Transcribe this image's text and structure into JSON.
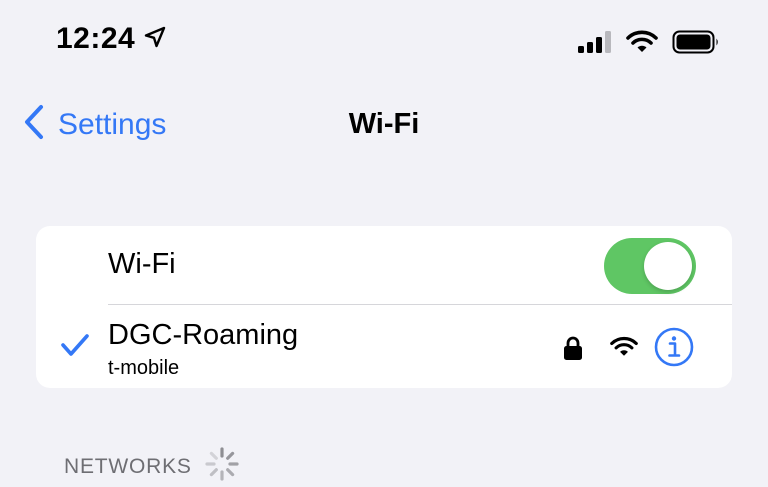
{
  "status_bar": {
    "time": "12:24",
    "icons": [
      "location-arrow-icon",
      "cellular-signal-icon",
      "wifi-icon",
      "battery-icon"
    ]
  },
  "nav": {
    "back_label": "Settings",
    "title": "Wi-Fi"
  },
  "wifi_toggle": {
    "label": "Wi-Fi",
    "on": true
  },
  "connected_network": {
    "name": "DGC-Roaming",
    "subtitle": "t-mobile",
    "secured": true
  },
  "networks_section": {
    "header": "NETWORKS"
  },
  "colors": {
    "accent": "#3478f6",
    "toggle_on": "#5fc664",
    "background": "#f2f2f7",
    "card": "#ffffff",
    "secondary_text": "#6e6e73"
  }
}
